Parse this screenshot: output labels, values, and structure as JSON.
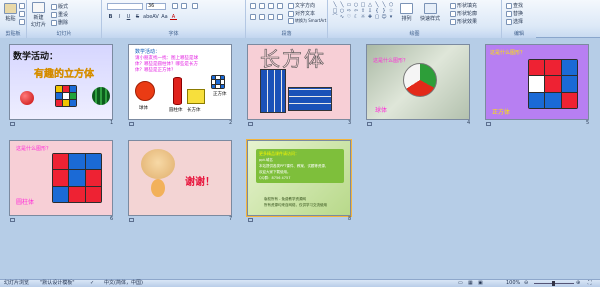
{
  "ribbon": {
    "groups": [
      {
        "label": "剪贴板"
      },
      {
        "label": "幻灯片"
      },
      {
        "label": "字体"
      },
      {
        "label": "段落"
      },
      {
        "label": "绘图"
      },
      {
        "label": "编辑"
      }
    ],
    "clipboard": {
      "paste": "粘贴",
      "format_painter": "格式刷"
    },
    "slides": {
      "new_slide": "新建\n幻灯片",
      "layout": "版式",
      "reset": "重设",
      "delete": "删除"
    },
    "font": {
      "font_name": "",
      "font_size": "36",
      "bold": "B",
      "italic": "I",
      "underline": "U",
      "strike": "S",
      "shadow": "abe",
      "spacing": "AV",
      "case": "Aa",
      "color": "A"
    },
    "paragraph": {
      "text_direction": "文字方向",
      "align_text": "对齐文本",
      "smartart": "转换为 SmartArt"
    },
    "drawing": {
      "arrange": "排列",
      "quick_styles": "快速样式",
      "shape_fill": "形状填充",
      "shape_outline": "形状轮廓",
      "shape_effects": "形状效果"
    },
    "editing": {
      "find": "查找",
      "replace": "替换",
      "select": "选择"
    }
  },
  "slides": [
    {
      "num": "1",
      "title": "数学活动：",
      "subtitle": "有趣的立方体"
    },
    {
      "num": "2",
      "heading": "数学活动：",
      "lines": [
        "请小朋友找一找：图上哪些是球",
        "体？哪些是圆柱体？哪些是长方",
        "体？哪些是正方体？"
      ],
      "labels": [
        "球体",
        "圆柱体",
        "长方体",
        "正方体"
      ]
    },
    {
      "num": "3",
      "title": "长方体"
    },
    {
      "num": "4",
      "question": "这是什么图形？",
      "answer": "球体"
    },
    {
      "num": "5",
      "question": "这是什么图形？",
      "answer": "正方体"
    },
    {
      "num": "6",
      "question": "这是什么图形？",
      "answer": "圆柱体"
    },
    {
      "num": "7",
      "text": "谢谢！"
    },
    {
      "num": "8",
      "title": "更多精品课件请访问：",
      "lines": [
        "ppt.域名",
        "本站提供各类PPT课件、教案、试题等资源，",
        "欢迎大家下载使用。",
        "QQ群：8756 4757"
      ],
      "footer": [
        "版权所有 - 免费教学资源网",
        "所有资源均来自网络，仅供学习交流使用"
      ]
    }
  ],
  "status": {
    "view": "幻灯片浏览",
    "theme": "\"默认设计模板\"",
    "language": "中文(简体，中国)",
    "zoom": "100%"
  },
  "colors": {
    "ribbon_bg": "#dde9f7",
    "sorter_bg": "#b6cde7",
    "selection": "#f3b43b"
  }
}
